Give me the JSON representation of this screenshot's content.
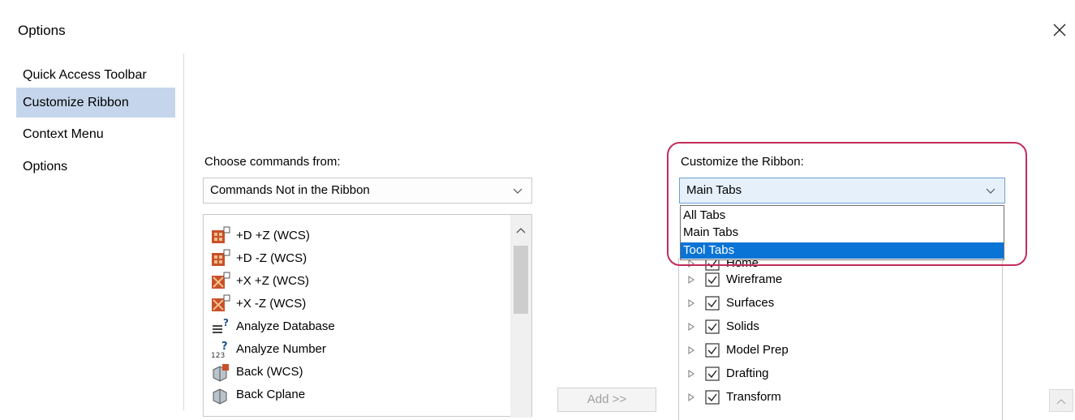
{
  "window": {
    "title": "Options"
  },
  "nav": {
    "items": [
      {
        "label": "Quick Access Toolbar",
        "selected": false
      },
      {
        "label": "Customize Ribbon",
        "selected": true
      },
      {
        "label": "Context Menu",
        "selected": false
      },
      {
        "label": "Options",
        "selected": false
      }
    ]
  },
  "commands": {
    "label": "Choose commands from:",
    "selected": "Commands Not in the Ribbon",
    "items": [
      {
        "label": "+D +Z (WCS)",
        "icon": "view-d-plus-z-icon"
      },
      {
        "label": "+D -Z (WCS)",
        "icon": "view-d-minus-z-icon"
      },
      {
        "label": "+X +Z (WCS)",
        "icon": "view-x-plus-z-icon"
      },
      {
        "label": "+X -Z (WCS)",
        "icon": "view-x-minus-z-icon"
      },
      {
        "label": "Analyze Database",
        "icon": "analyze-database-icon"
      },
      {
        "label": "Analyze Number",
        "icon": "analyze-number-icon"
      },
      {
        "label": "Back (WCS)",
        "icon": "back-view-icon"
      },
      {
        "label": "Back Cplane",
        "icon": "back-cplane-icon"
      }
    ]
  },
  "add_button": {
    "label": "Add >>"
  },
  "ribbon": {
    "label": "Customize the Ribbon:",
    "selected": "Main Tabs",
    "options": [
      {
        "label": "All Tabs",
        "highlighted": false
      },
      {
        "label": "Main Tabs",
        "highlighted": false
      },
      {
        "label": "Tool Tabs",
        "highlighted": true
      }
    ],
    "tabs": [
      {
        "label": "Home",
        "checked": true
      },
      {
        "label": "Wireframe",
        "checked": true
      },
      {
        "label": "Surfaces",
        "checked": true
      },
      {
        "label": "Solids",
        "checked": true
      },
      {
        "label": "Model Prep",
        "checked": true
      },
      {
        "label": "Drafting",
        "checked": true
      },
      {
        "label": "Transform",
        "checked": true
      }
    ]
  },
  "colors": {
    "nav_selected": "#c5d6ec",
    "dropdown_highlight": "#0a74d6",
    "annotation_ring": "#c12d5a"
  }
}
